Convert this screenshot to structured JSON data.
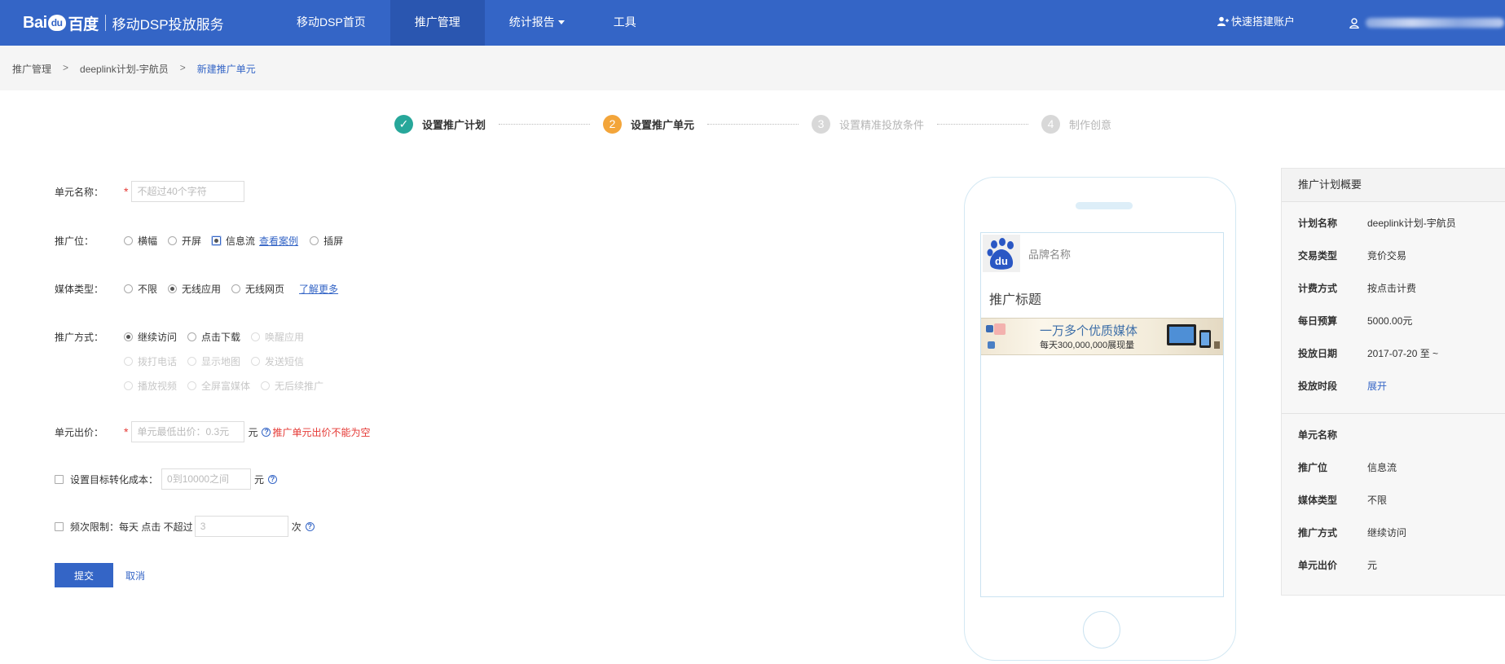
{
  "header": {
    "logo_mark": "Bai",
    "logo_du": "du",
    "logo_cn": "百度",
    "logo_sub": "移动DSP投放服务",
    "nav": [
      {
        "label": "移动DSP首页"
      },
      {
        "label": "推广管理"
      },
      {
        "label": "统计报告"
      },
      {
        "label": "工具"
      }
    ],
    "quick_label": "快速搭建账户"
  },
  "breadcrumb": {
    "items": [
      "推广管理",
      "deeplink计划-宇航员",
      "新建推广单元"
    ],
    "separator": ">"
  },
  "steps": [
    {
      "num": "✓",
      "label": "设置推广计划",
      "state": "done"
    },
    {
      "num": "2",
      "label": "设置推广单元",
      "state": "current"
    },
    {
      "num": "3",
      "label": "设置精准投放条件",
      "state": "todo"
    },
    {
      "num": "4",
      "label": "制作创意",
      "state": "todo"
    }
  ],
  "form": {
    "unit_name_label": "单元名称：",
    "unit_name_placeholder": "不超过40个字符",
    "position_label": "推广位：",
    "position_options": [
      "横幅",
      "开屏",
      "信息流",
      "插屏"
    ],
    "position_case_link": "查看案例",
    "media_label": "媒体类型：",
    "media_options": [
      "不限",
      "无线应用",
      "无线网页"
    ],
    "media_more_link": "了解更多",
    "method_label": "推广方式：",
    "method_row1": [
      "继续访问",
      "点击下载",
      "唤醒应用"
    ],
    "method_row2": [
      "拨打电话",
      "显示地图",
      "发送短信"
    ],
    "method_row3": [
      "播放视频",
      "全屏富媒体",
      "无后续推广"
    ],
    "bid_label": "单元出价：",
    "bid_placeholder": "单元最低出价：0.3元",
    "bid_unit": "元",
    "bid_error": "推广单元出价不能为空",
    "target_cost_label": "设置目标转化成本：",
    "target_cost_placeholder": "0到10000之间",
    "target_cost_unit": "元",
    "freq_label": "频次限制：",
    "freq_text": "每天 点击 不超过",
    "freq_value": "3",
    "freq_unit": "次",
    "submit_label": "提交",
    "cancel_label": "取消"
  },
  "preview": {
    "paw_text": "du",
    "brand": "品牌名称",
    "title": "推广标题",
    "banner_line1": "一万多个优质媒体",
    "banner_line2": "每天300,000,000展现量"
  },
  "summary": {
    "title": "推广计划概要",
    "plan_rows": [
      {
        "key": "计划名称",
        "value": "deeplink计划-宇航员"
      },
      {
        "key": "交易类型",
        "value": "竞价交易"
      },
      {
        "key": "计费方式",
        "value": "按点击计费"
      },
      {
        "key": "每日预算",
        "value": "5000.00元"
      },
      {
        "key": "投放日期",
        "value": "2017-07-20 至 ~"
      },
      {
        "key": "投放时段",
        "value": "展开"
      }
    ],
    "unit_rows": [
      {
        "key": "单元名称",
        "value": ""
      },
      {
        "key": "推广位",
        "value": "信息流"
      },
      {
        "key": "媒体类型",
        "value": "不限"
      },
      {
        "key": "推广方式",
        "value": "继续访问"
      },
      {
        "key": "单元出价",
        "value": "元"
      }
    ]
  },
  "colors": {
    "brand_blue": "#3465c6",
    "step_done": "#27a79a",
    "step_current": "#f3a53a",
    "error_red": "#e53935"
  }
}
